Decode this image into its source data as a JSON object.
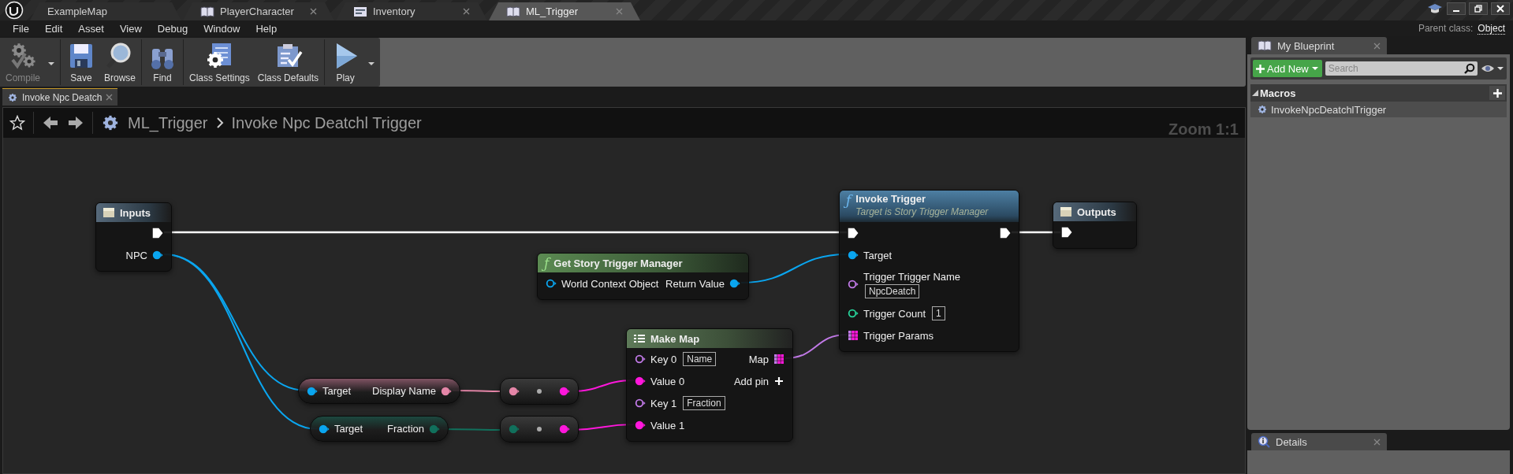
{
  "editor_tabs": [
    {
      "label": "ExampleMap",
      "kind": "map",
      "selected": false,
      "closable": false
    },
    {
      "label": "PlayerCharacter",
      "kind": "blueprint",
      "selected": false,
      "closable": true
    },
    {
      "label": "Inventory",
      "kind": "struct",
      "selected": false,
      "closable": true
    },
    {
      "label": "ML_Trigger",
      "kind": "blueprint",
      "selected": true,
      "closable": true
    }
  ],
  "menu": [
    "File",
    "Edit",
    "Asset",
    "View",
    "Debug",
    "Window",
    "Help"
  ],
  "parent_class": {
    "label": "Parent class:",
    "value": "Object"
  },
  "toolbar_groups": [
    [
      {
        "label": "Compile",
        "kind": "compile",
        "disabled": true,
        "dropdown": true
      }
    ],
    [
      {
        "label": "Save",
        "kind": "save",
        "disabled": false,
        "dropdown": false
      },
      {
        "label": "Browse",
        "kind": "browse",
        "disabled": false,
        "dropdown": false
      }
    ],
    [
      {
        "label": "Find",
        "kind": "find",
        "disabled": false,
        "dropdown": false
      }
    ],
    [
      {
        "label": "Class Settings",
        "kind": "settings",
        "disabled": false,
        "dropdown": false
      },
      {
        "label": "Class Defaults",
        "kind": "defaults",
        "disabled": false,
        "dropdown": false
      }
    ],
    [
      {
        "label": "Play",
        "kind": "play",
        "disabled": false,
        "dropdown": true
      }
    ]
  ],
  "document_tab": {
    "label": "Invoke Npc Deatch",
    "closable": true
  },
  "graph": {
    "breadcrumb": [
      "ML_Trigger",
      "Invoke Npc Deatchl Trigger"
    ],
    "zoom": "Zoom 1:1",
    "nodes": [
      {
        "kind": "tunnel",
        "title": "Inputs",
        "outputs": [
          {
            "kind": "exec",
            "connected": true
          },
          {
            "kind": "object",
            "label": "NPC",
            "connected": true
          }
        ]
      },
      {
        "kind": "function",
        "glyph": "ƒ",
        "title": "Invoke Trigger",
        "subtitle": "Target is Story Trigger Manager",
        "inputs": [
          {
            "kind": "exec",
            "connected": true
          },
          {
            "kind": "object",
            "label": "Target",
            "connected": true
          },
          {
            "kind": "name",
            "label": "Trigger Trigger Name",
            "value": "NpcDeatch",
            "connected": false
          },
          {
            "kind": "int",
            "label": "Trigger Count",
            "value": "1",
            "connected": false
          },
          {
            "kind": "map",
            "label": "Trigger Params",
            "connected": true
          }
        ],
        "outputs": [
          {
            "kind": "exec",
            "connected": true
          }
        ]
      },
      {
        "kind": "tunnel",
        "title": "Outputs",
        "inputs": [
          {
            "kind": "exec",
            "connected": true
          }
        ]
      },
      {
        "kind": "pure_function",
        "glyph": "ƒ",
        "title": "Get Story Trigger Manager",
        "inputs": [
          {
            "kind": "object",
            "label": "World Context Object",
            "connected": false
          }
        ],
        "outputs": [
          {
            "kind": "object",
            "label": "Return Value",
            "connected": true
          }
        ]
      },
      {
        "kind": "make_map",
        "title": "Make Map",
        "inputs": [
          {
            "kind": "name",
            "label": "Key 0",
            "value": "Name",
            "connected": false
          },
          {
            "kind": "string",
            "label": "Value 0",
            "connected": true
          },
          {
            "kind": "name",
            "label": "Key 1",
            "value": "Fraction",
            "connected": false
          },
          {
            "kind": "string",
            "label": "Value 1",
            "connected": true
          }
        ],
        "outputs": [
          {
            "kind": "map",
            "label": "Map",
            "connected": true
          },
          {
            "kind": "add",
            "label": "Add pin"
          }
        ]
      },
      {
        "kind": "compact",
        "inputs": [
          {
            "kind": "object",
            "label": "Target",
            "connected": true
          }
        ],
        "outputs": [
          {
            "kind": "text",
            "label": "Display Name",
            "connected": true
          }
        ]
      },
      {
        "kind": "compact",
        "inputs": [
          {
            "kind": "object",
            "label": "Target",
            "connected": true
          }
        ],
        "outputs": [
          {
            "kind": "float",
            "label": "Fraction",
            "connected": true
          }
        ]
      },
      {
        "kind": "conversion",
        "inputs": [
          {
            "kind": "text",
            "connected": true
          }
        ],
        "outputs": [
          {
            "kind": "string",
            "connected": true
          }
        ]
      },
      {
        "kind": "conversion",
        "inputs": [
          {
            "kind": "float",
            "connected": true
          }
        ],
        "outputs": [
          {
            "kind": "string",
            "connected": true
          }
        ]
      }
    ]
  },
  "my_blueprint": {
    "tab": "My Blueprint",
    "add_new": "Add New",
    "search_placeholder": "Search",
    "sections": [
      {
        "title": "Macros",
        "expanded": true,
        "items": [
          "InvokeNpcDeatchlTrigger"
        ]
      }
    ]
  },
  "details": {
    "tab": "Details"
  }
}
